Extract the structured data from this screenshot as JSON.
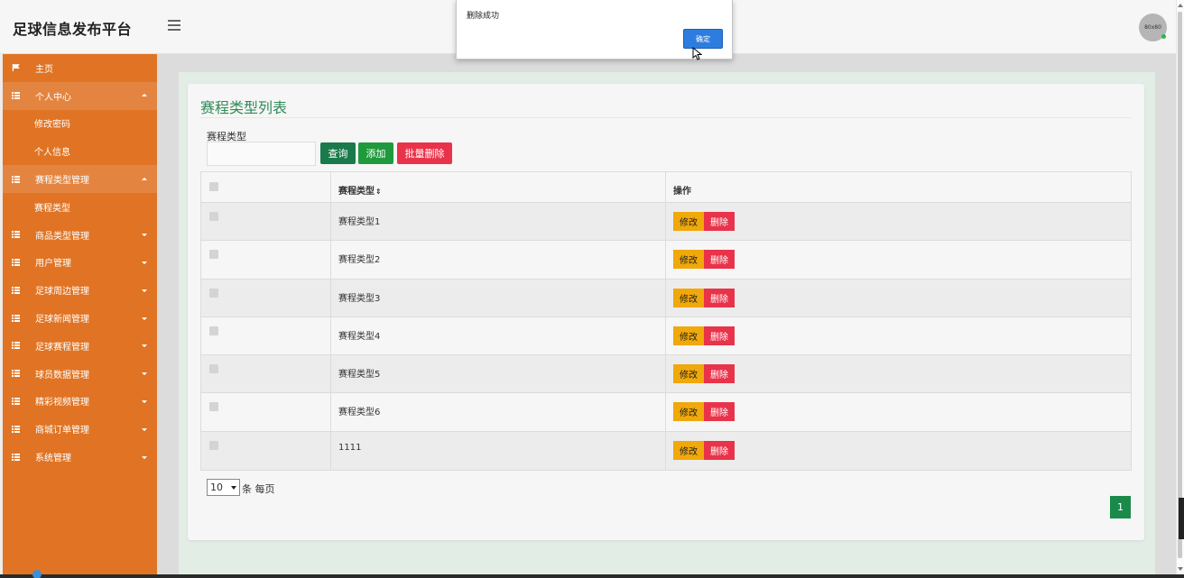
{
  "app": {
    "title": "足球信息发布平台",
    "avatar_text": "80x80"
  },
  "sidebar": {
    "items": [
      {
        "label": "主页",
        "icon": "flag-icon",
        "sub": false,
        "open": false,
        "caret": ""
      },
      {
        "label": "个人中心",
        "icon": "grid-icon",
        "sub": false,
        "open": true,
        "caret": "up"
      },
      {
        "label": "修改密码",
        "icon": "",
        "sub": true,
        "open": false,
        "caret": ""
      },
      {
        "label": "个人信息",
        "icon": "",
        "sub": true,
        "open": false,
        "caret": ""
      },
      {
        "label": "赛程类型管理",
        "icon": "grid-icon",
        "sub": false,
        "open": true,
        "caret": "up"
      },
      {
        "label": "赛程类型",
        "icon": "",
        "sub": true,
        "open": false,
        "caret": ""
      },
      {
        "label": "商品类型管理",
        "icon": "grid-icon",
        "sub": false,
        "open": false,
        "caret": "down"
      },
      {
        "label": "用户管理",
        "icon": "grid-icon",
        "sub": false,
        "open": false,
        "caret": "down"
      },
      {
        "label": "足球周边管理",
        "icon": "grid-icon",
        "sub": false,
        "open": false,
        "caret": "down"
      },
      {
        "label": "足球新闻管理",
        "icon": "grid-icon",
        "sub": false,
        "open": false,
        "caret": "down"
      },
      {
        "label": "足球赛程管理",
        "icon": "grid-icon",
        "sub": false,
        "open": false,
        "caret": "down"
      },
      {
        "label": "球员数据管理",
        "icon": "grid-icon",
        "sub": false,
        "open": false,
        "caret": "down"
      },
      {
        "label": "精彩视频管理",
        "icon": "grid-icon",
        "sub": false,
        "open": false,
        "caret": "down"
      },
      {
        "label": "商城订单管理",
        "icon": "grid-icon",
        "sub": false,
        "open": false,
        "caret": "down"
      },
      {
        "label": "系统管理",
        "icon": "grid-icon",
        "sub": false,
        "open": false,
        "caret": "down"
      }
    ]
  },
  "main": {
    "title": "赛程类型列表",
    "search_label": "赛程类型",
    "search_value": "",
    "buttons": {
      "query": "查询",
      "add": "添加",
      "batch_delete": "批量删除"
    },
    "table": {
      "headers": [
        "",
        "赛程类型",
        "操作"
      ],
      "sort_icon": "⇕",
      "rows": [
        {
          "name": "赛程类型1"
        },
        {
          "name": "赛程类型2"
        },
        {
          "name": "赛程类型3"
        },
        {
          "name": "赛程类型4"
        },
        {
          "name": "赛程类型5"
        },
        {
          "name": "赛程类型6"
        },
        {
          "name": "1111"
        }
      ],
      "edit_label": "修改",
      "delete_label": "删除"
    },
    "page_size": "10",
    "page_size_suffix": "条 每页",
    "current_page": "1"
  },
  "dialog": {
    "message": "删除成功",
    "ok_label": "确定"
  },
  "colors": {
    "sidebar": "#e07424",
    "title": "#2e8b57",
    "edit": "#f0a80a",
    "delete": "#e9334a",
    "query": "#1a7a4c",
    "add": "#1e9a3c",
    "ok": "#2d7de0"
  }
}
